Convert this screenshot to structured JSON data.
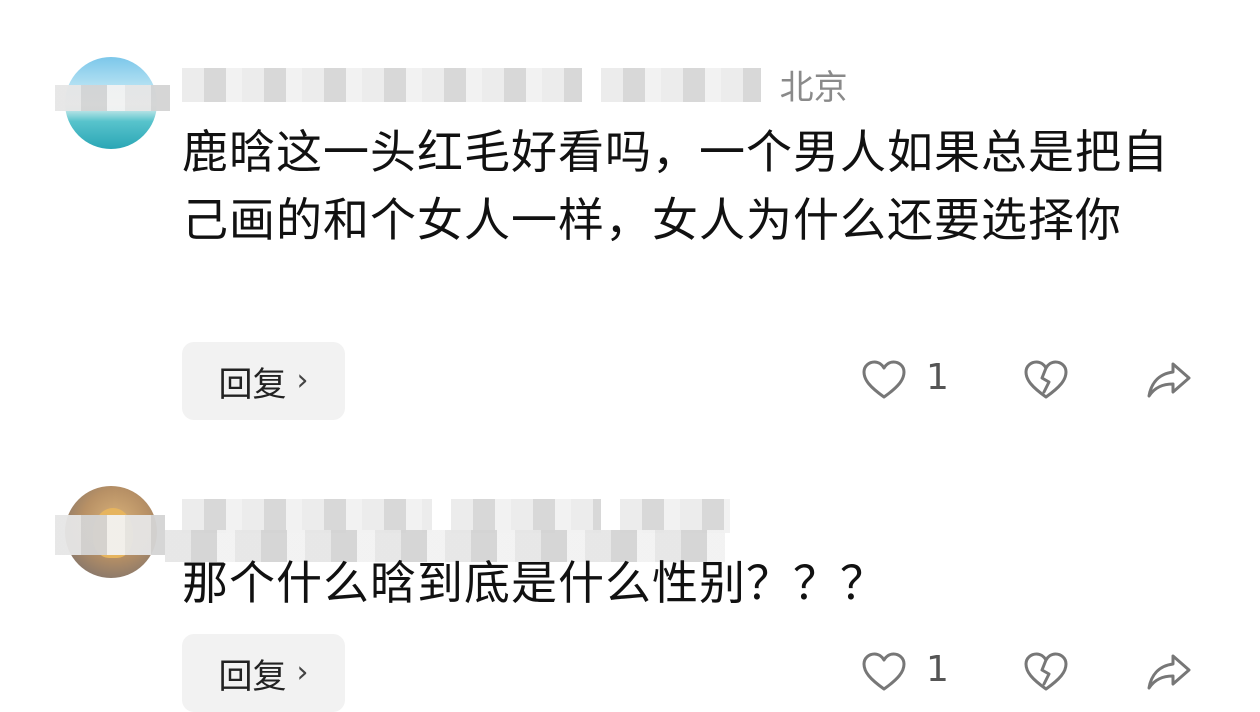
{
  "comments": [
    {
      "location": "北京",
      "text": "鹿晗这一头红毛好看吗，一个男人如果总是把自己画的和个女人一样，女人为什么还要选择你",
      "reply_label": "回复",
      "like_count": "1"
    },
    {
      "text": "那个什么晗到底是什么性别？？？",
      "reply_label": "回复",
      "like_count": "1"
    }
  ],
  "icons": {
    "like": "heart-outline-icon",
    "dislike": "broken-heart-icon",
    "share": "share-arrow-icon",
    "chevron": "chevron-right-icon"
  }
}
